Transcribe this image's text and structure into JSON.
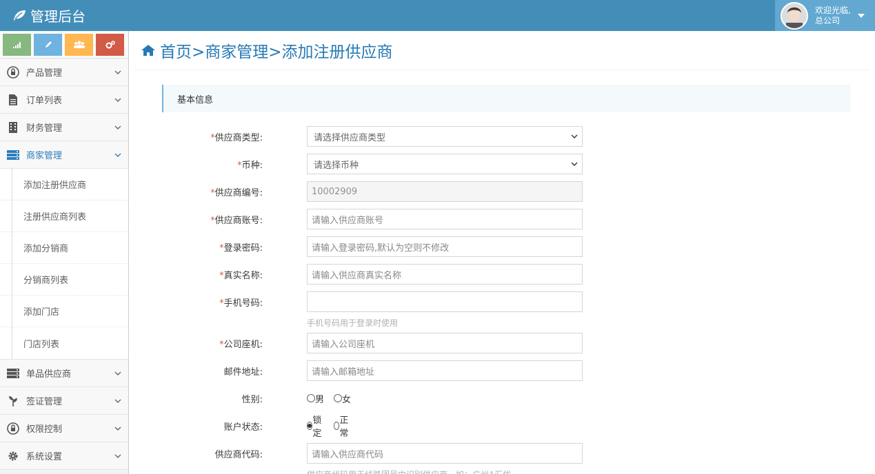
{
  "brand": {
    "title": "管理后台"
  },
  "user": {
    "greeting": "欢迎光临,",
    "company": "总公司"
  },
  "colors": {
    "navbar": "#438eb9",
    "shortcut_1": "#87b87f",
    "shortcut_2": "#6fb3e0",
    "shortcut_3": "#ffb752",
    "shortcut_4": "#d15b47",
    "accent": "#2679b5"
  },
  "shortcuts": [
    {
      "icon": "signal-icon"
    },
    {
      "icon": "pencil-icon"
    },
    {
      "icon": "users-icon"
    },
    {
      "icon": "cogs-icon"
    }
  ],
  "sidebar": {
    "items": [
      {
        "label": "产品管理",
        "icon": "lock-icon"
      },
      {
        "label": "订单列表",
        "icon": "file-icon"
      },
      {
        "label": "财务管理",
        "icon": "building-icon"
      },
      {
        "label": "商家管理",
        "icon": "server-icon"
      },
      {
        "label": "单品供应商",
        "icon": "server-icon"
      },
      {
        "label": "签证管理",
        "icon": "leaf-icon"
      },
      {
        "label": "权限控制",
        "icon": "lock-icon"
      },
      {
        "label": "系统设置",
        "icon": "gear-icon"
      }
    ],
    "submenu": [
      "添加注册供应商",
      "注册供应商列表",
      "添加分销商",
      "分销商列表",
      "添加门店",
      "门店列表"
    ]
  },
  "breadcrumb": "首页>商家管理>添加注册供应商",
  "section": {
    "title": "基本信息"
  },
  "form": {
    "supplier_type": {
      "label": "供应商类型:",
      "placeholder": "请选择供应商类型"
    },
    "currency": {
      "label": "币种:",
      "placeholder": "请选择币种"
    },
    "supplier_no": {
      "label": "供应商编号:",
      "value": "10002909"
    },
    "account": {
      "label": "供应商账号:",
      "placeholder": "请输入供应商账号"
    },
    "password": {
      "label": "登录密码:",
      "placeholder": "请输入登录密码,默认为空则不修改"
    },
    "real_name": {
      "label": "真实名称:",
      "placeholder": "请输入供应商真实名称"
    },
    "mobile": {
      "label": "手机号码:",
      "placeholder": "",
      "help": "手机号码用于登录时使用"
    },
    "landline": {
      "label": "公司座机:",
      "placeholder": "请输入公司座机"
    },
    "email": {
      "label": "邮件地址:",
      "placeholder": "请输入邮箱地址"
    },
    "gender": {
      "label": "性别:",
      "options": [
        "男",
        "女"
      ]
    },
    "status": {
      "label": "账户状态:",
      "options": [
        "锁定",
        "正常"
      ],
      "selected": "锁定"
    },
    "code": {
      "label": "供应商代码:",
      "placeholder": "请输入供应商代码",
      "help": "供应商代码用于线路团号中识别供应商，如：广州A汇优"
    }
  }
}
